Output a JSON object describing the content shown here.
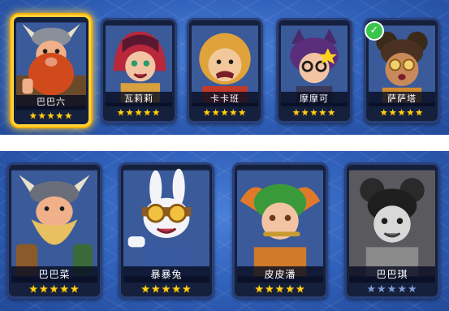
{
  "top_row": {
    "heroes": [
      {
        "name": "巴巴六",
        "stars": "★★★★★",
        "selected": true,
        "owned": false
      },
      {
        "name": "瓦莉莉",
        "stars": "★★★★★",
        "selected": false,
        "owned": false
      },
      {
        "name": "卡卡班",
        "stars": "★★★★★",
        "selected": false,
        "owned": false
      },
      {
        "name": "摩摩可",
        "stars": "★★★★★",
        "selected": false,
        "owned": false
      },
      {
        "name": "萨萨塔",
        "stars": "★★★★★",
        "selected": false,
        "owned": true
      }
    ]
  },
  "bottom_row": {
    "heroes": [
      {
        "name": "巴巴菜",
        "stars": "★★★★★",
        "locked": false
      },
      {
        "name": "暴暴兔",
        "stars": "★★★★★",
        "locked": false
      },
      {
        "name": "皮皮潘",
        "stars": "★★★★★",
        "locked": false
      },
      {
        "name": "巴巴琪",
        "stars": "★★★★★",
        "locked": true
      }
    ]
  },
  "icons": {
    "owned_check": "✓"
  },
  "colors": {
    "background": "#3a6cc8",
    "selected_border": "#ffd33b",
    "star": "#ffd21a",
    "star_locked": "#7f9bd8",
    "check": "#39c64a"
  }
}
